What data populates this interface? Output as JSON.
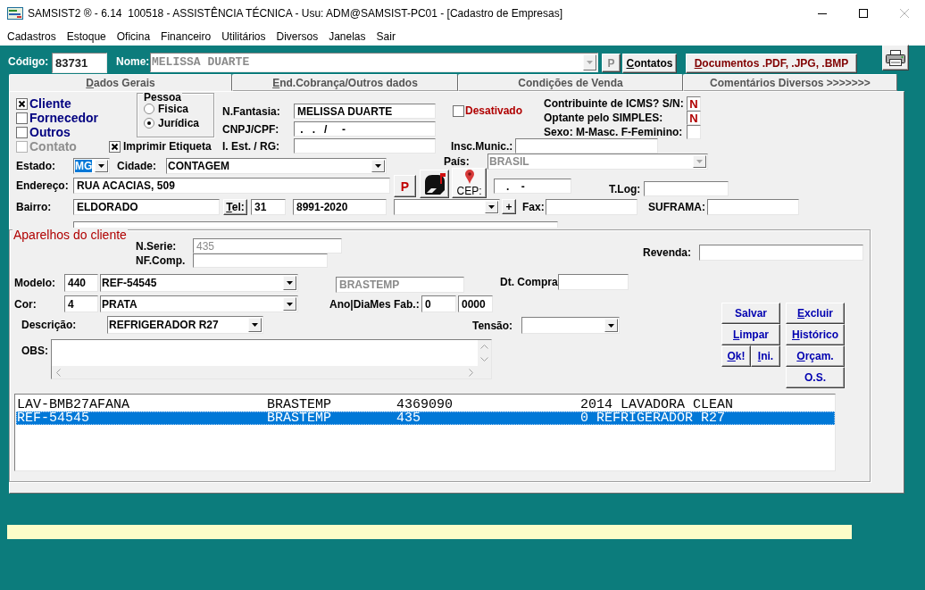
{
  "window": {
    "title": "SAMSIST2 ® - 6.14  100518 - ASSISTÊNCIA TÉCNICA - Usu: ADM@SAMSIST-PC01 - [Cadastro de Empresas]"
  },
  "menu": [
    "Cadastros",
    "Estoque",
    "Oficina",
    "Financeiro",
    "Utilitários",
    "Diversos",
    "Janelas",
    "Sair"
  ],
  "header": {
    "codigo": {
      "label": "Código:",
      "value": "83731"
    },
    "nome": {
      "label": "Nome:",
      "value": "MELISSA DUARTE",
      "disabled": true
    },
    "p_button": {
      "label": "P",
      "disabled": true
    },
    "contatos_button": {
      "label": "Contatos",
      "mnemonic": true
    },
    "documentos_button": {
      "label": "Documentos .PDF, .JPG, .BMP",
      "mnemonic": true
    }
  },
  "tabs": [
    {
      "label": "Dados Gerais",
      "selected": true,
      "mnemonic": true
    },
    {
      "label": "End.Cobrança/Outros dados",
      "selected": false,
      "mnemonic": true
    },
    {
      "label": "Condições de Venda",
      "selected": false,
      "mnemonic": false
    },
    {
      "label": "Comentários Diversos >>>>>>>",
      "selected": false,
      "mnemonic": false
    }
  ],
  "dados_gerais": {
    "tipo": [
      {
        "label": "Cliente",
        "checked": true,
        "disabled": false
      },
      {
        "label": "Fornecedor",
        "checked": false,
        "disabled": false
      },
      {
        "label": "Outros",
        "checked": false,
        "disabled": false
      },
      {
        "label": "Contato",
        "checked": false,
        "disabled": true
      }
    ],
    "pessoa": {
      "title": "Pessoa",
      "options": [
        {
          "label": "Fisica",
          "selected": false
        },
        {
          "label": "Jurídica",
          "selected": true
        }
      ]
    },
    "imprimir_etiqueta": {
      "label": "Imprimir Etiqueta",
      "checked": true
    },
    "n_fantasia": {
      "label": "N.Fantasia:",
      "value": "MELISSA DUARTE"
    },
    "cnpj_cpf": {
      "label": "CNPJ/CPF:",
      "value": " .   .   /     -"
    },
    "ie_rg": {
      "label": "I. Est. / RG:"
    },
    "desativado": {
      "label": "Desativado",
      "checked": false
    },
    "flags": [
      {
        "label": "Contribuinte de ICMS? S/N:",
        "value": "N"
      },
      {
        "label": "Optante pelo SIMPLES:",
        "value": "N"
      },
      {
        "label": "Sexo: M-Masc. F-Feminino:"
      }
    ],
    "insc_munic": {
      "label": "Insc.Munic.:"
    },
    "estado": {
      "label": "Estado:",
      "value": "MG",
      "text_selected": true
    },
    "cidade": {
      "label": "Cidade:",
      "value": "CONTAGEM"
    },
    "pais": {
      "label": "País:",
      "value": "BRASIL",
      "disabled": true
    },
    "endereco": {
      "label": "Endereço:",
      "value": "RUA ACACIAS, 509",
      "button": "P"
    },
    "cep": {
      "label": "CEP:",
      "value": "   .    -"
    },
    "t_log": {
      "label": "T.Log:"
    },
    "bairro": {
      "label": "Bairro:",
      "value": "ELDORADO"
    },
    "tel": {
      "label": "Tel:",
      "mnemonic": true,
      "ddd": "31",
      "number": "8991-2020"
    },
    "add_button": "+",
    "fax": {
      "label": "Fax:"
    },
    "suframa": {
      "label": "SUFRAMA:"
    }
  },
  "aparelhos": {
    "title": "Aparelhos do cliente",
    "n_serie": {
      "label": "N.Serie:",
      "value": "435",
      "disabled": true
    },
    "nf_comp": {
      "label": "NF.Comp."
    },
    "revenda": {
      "label": "Revenda:"
    },
    "modelo": {
      "label": "Modelo:",
      "code": "440",
      "value": "REF-54545"
    },
    "marca": {
      "value": "BRASTEMP",
      "disabled": true
    },
    "dt_compra": {
      "label": "Dt. Compra"
    },
    "cor": {
      "label": "Cor:",
      "code": "4",
      "value": "PRATA"
    },
    "fabricacao": {
      "label": "Ano|DiaMes Fab.:",
      "ano": "0",
      "dia_mes": "0000"
    },
    "descricao": {
      "label": "Descrição:",
      "value": "REFRIGERADOR R27"
    },
    "tensao": {
      "label": "Tensão:"
    },
    "obs": {
      "label": "OBS:"
    },
    "buttons": [
      [
        {
          "label": "Salvar",
          "kind": "wide",
          "mnemonic": false
        },
        {
          "label": "Excluir",
          "kind": "wide",
          "mnemonic": true
        }
      ],
      [
        {
          "label": "Limpar",
          "kind": "wide",
          "mnemonic": true
        },
        {
          "label": "Histórico",
          "kind": "wide",
          "mnemonic": true
        }
      ],
      [
        {
          "label": "Ok!",
          "kind": "half",
          "mnemonic": true
        },
        {
          "label": "Ini.",
          "kind": "half",
          "mnemonic": true
        },
        {
          "label": "Orçam.",
          "kind": "wide",
          "mnemonic": true
        }
      ],
      [
        {
          "label": "O.S.",
          "kind": "wide",
          "mnemonic": false
        }
      ]
    ],
    "list": {
      "rows": [
        {
          "cells": [
            "LAV-BMB27AFANA",
            "BRASTEMP",
            "4369090",
            "2014 LAVADORA CLEAN"
          ],
          "selected": false
        },
        {
          "cells": [
            "REF-54545",
            "BRASTEMP",
            "435",
            "0 REFRIGERADOR R27"
          ],
          "selected": true
        }
      ]
    }
  }
}
